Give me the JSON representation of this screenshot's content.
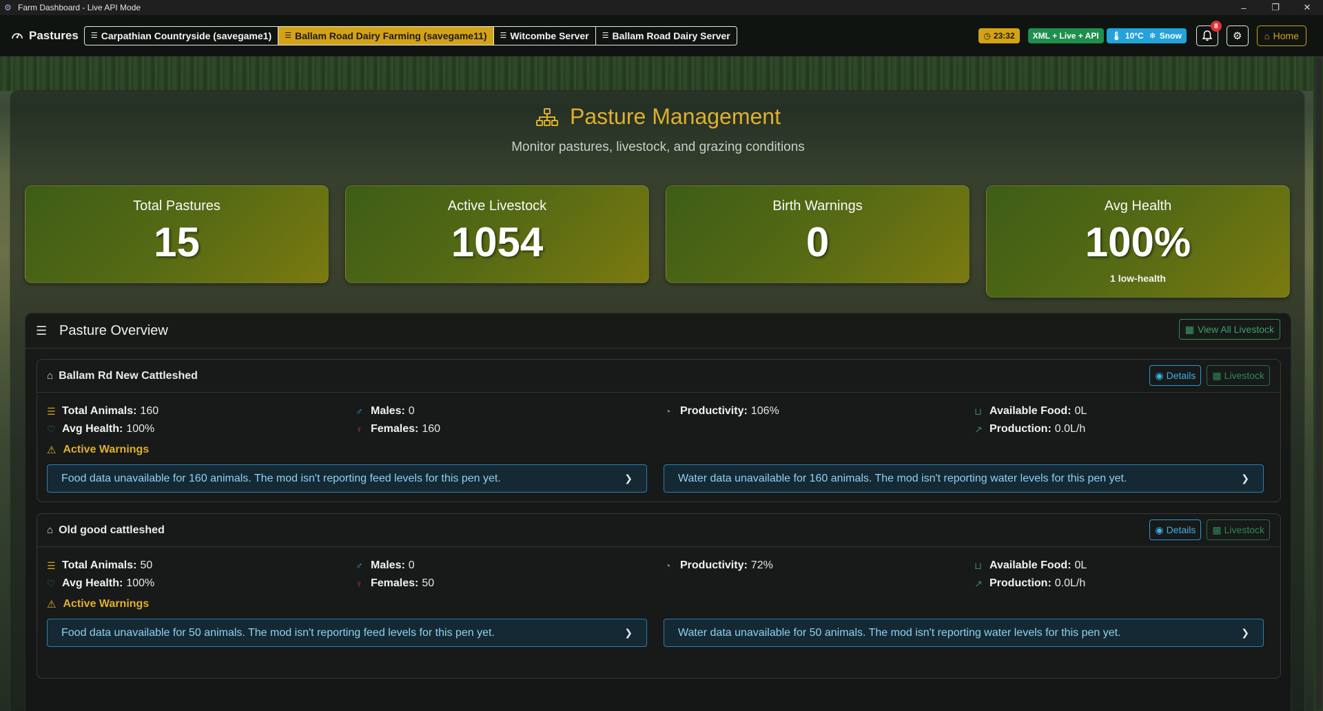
{
  "window": {
    "title": "Farm Dashboard - Live API Mode",
    "controls": [
      "–",
      "❐",
      "✕"
    ]
  },
  "navbar": {
    "brand": "Pastures",
    "tabs": [
      {
        "label": "Carpathian Countryside (savegame1)",
        "active": false
      },
      {
        "label": "Ballam Road Dairy Farming (savegame11)",
        "active": true
      },
      {
        "label": "Witcombe Server",
        "active": false
      },
      {
        "label": "Ballam Road Dairy Server",
        "active": false
      }
    ],
    "time": "23:32",
    "mode": "XML + Live + API",
    "weather": {
      "temp": "10°C",
      "condition": "Snow"
    },
    "notifications": "8",
    "home_label": "Home"
  },
  "page": {
    "title": "Pasture Management",
    "subtitle": "Monitor pastures, livestock, and grazing conditions"
  },
  "stats": [
    {
      "label": "Total Pastures",
      "value": "15",
      "sub": ""
    },
    {
      "label": "Active Livestock",
      "value": "1054",
      "sub": ""
    },
    {
      "label": "Birth Warnings",
      "value": "0",
      "sub": ""
    },
    {
      "label": "Avg Health",
      "value": "100%",
      "sub": "1 low-health"
    }
  ],
  "overview": {
    "title": "Pasture Overview",
    "view_all_label": "View All Livestock",
    "details_label": "Details",
    "livestock_label": "Livestock",
    "warnings_title": "Active Warnings",
    "labels": {
      "total_animals": "Total Animals:",
      "avg_health": "Avg Health:",
      "males": "Males:",
      "females": "Females:",
      "productivity": "Productivity:",
      "available_food": "Available Food:",
      "production": "Production:"
    },
    "pastures": [
      {
        "name": "Ballam Rd New Cattleshed",
        "total_animals": "160",
        "avg_health": "100%",
        "males": "0",
        "females": "160",
        "productivity": "106%",
        "available_food": "0L",
        "production": "0.0L/h",
        "warnings": [
          "Food data unavailable for 160 animals. The mod isn't reporting feed levels for this pen yet.",
          "Water data unavailable for 160 animals. The mod isn't reporting water levels for this pen yet."
        ]
      },
      {
        "name": "Old good cattleshed",
        "total_animals": "50",
        "avg_health": "100%",
        "males": "0",
        "females": "50",
        "productivity": "72%",
        "available_food": "0L",
        "production": "0.0L/h",
        "warnings": [
          "Food data unavailable for 50 animals. The mod isn't reporting feed levels for this pen yet.",
          "Water data unavailable for 50 animals. The mod isn't reporting water levels for this pen yet."
        ]
      }
    ]
  },
  "colors": {
    "accent": "#d4a215",
    "active_tab": "#d4a215",
    "mode_badge": "#1f8f4e",
    "weather_badge": "#23a3d9",
    "notification": "#e0323a",
    "info": "#3cb2ea",
    "success": "#2e8b57"
  }
}
